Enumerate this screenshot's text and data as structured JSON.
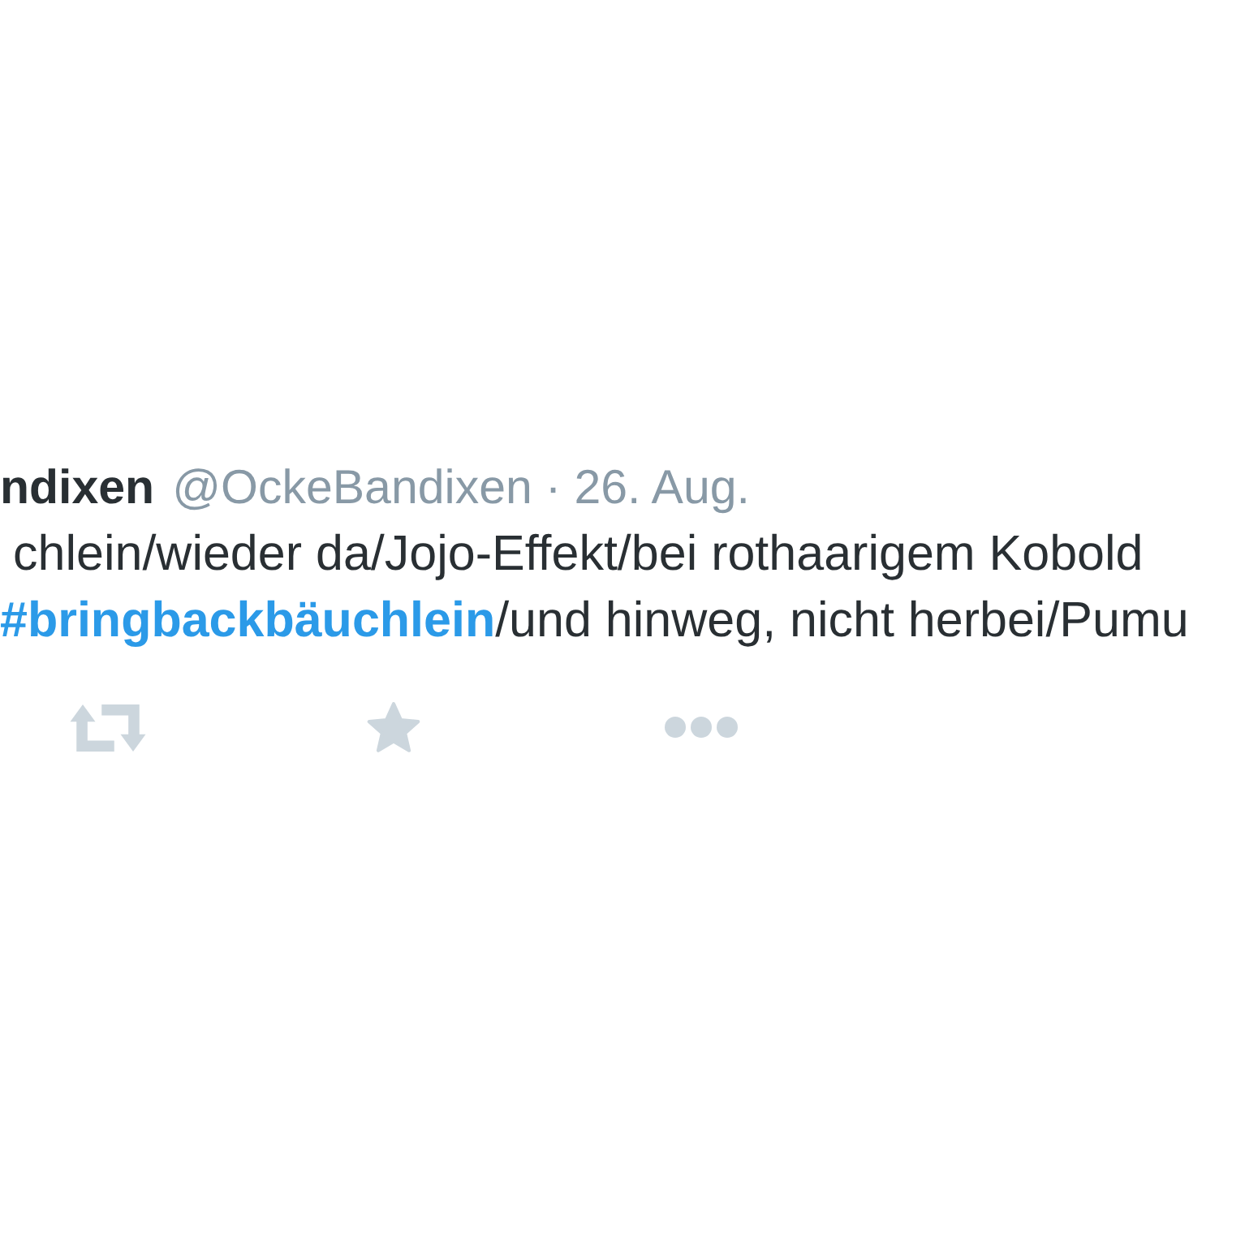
{
  "tweet": {
    "author": {
      "name": "ndixen",
      "handle": "@OckeBandixen",
      "separator": "·",
      "time": "26. Aug."
    },
    "lines": [
      {
        "segments": [
          {
            "kind": "text",
            "text": "chlein/wieder da/Jojo-Effekt/bei rothaarigem Kobold"
          }
        ]
      },
      {
        "segments": [
          {
            "kind": "hashtag",
            "text": "#bringbackbäuchlein"
          },
          {
            "kind": "text",
            "text": "/und hinweg, nicht herbei/Pumu"
          }
        ]
      }
    ],
    "actions": [
      {
        "kind": "retweet"
      },
      {
        "kind": "favorite"
      },
      {
        "kind": "more"
      }
    ]
  }
}
